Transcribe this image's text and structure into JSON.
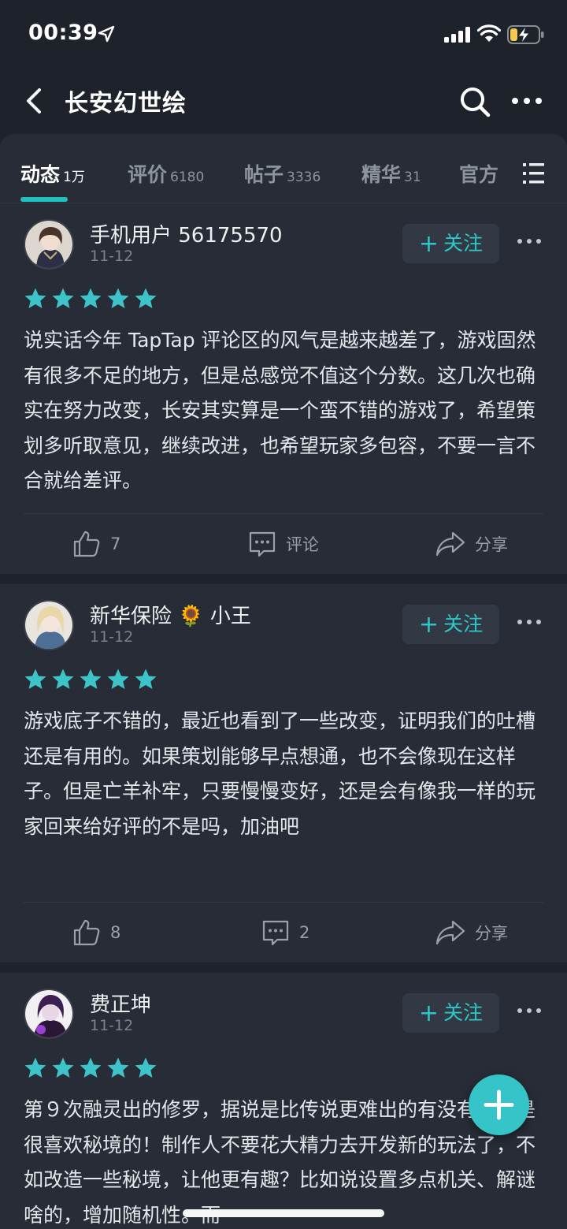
{
  "status_bar": {
    "time": "00:39"
  },
  "nav": {
    "title": "长安幻世绘"
  },
  "tabs": [
    {
      "label": "动态",
      "count": "1万",
      "active": true
    },
    {
      "label": "评价",
      "count": "6180",
      "active": false
    },
    {
      "label": "帖子",
      "count": "3336",
      "active": false
    },
    {
      "label": "精华",
      "count": "31",
      "active": false
    },
    {
      "label": "官方",
      "count": "",
      "active": false
    }
  ],
  "follow_label": "关注",
  "reviews": [
    {
      "username": "手机用户 56175570",
      "date": "11-12",
      "rating": 5,
      "text": "说实话今年 TapTap 评论区的风气是越来越差了，游戏固然有很多不足的地方，但是总感觉不值这个分数。这几次也确实在努力改变，长安其实算是一个蛮不错的游戏了，希望策划多听取意见，继续改进，也希望玩家多包容，不要一言不合就给差评。",
      "likes": "7",
      "comments": "评论",
      "share": "分享"
    },
    {
      "username": "新华保险 🌻 小王",
      "date": "11-12",
      "rating": 5,
      "text": "游戏底子不错的，最近也看到了一些改变，证明我们的吐槽还是有用的。如果策划能够早点想通，也不会像现在这样子。但是亡羊补牢，只要慢慢变好，还是会有像我一样的玩家回来给好评的不是吗，加油吧",
      "likes": "8",
      "comments": "2",
      "share": "分享"
    },
    {
      "username": "费正坤",
      "date": "11-12",
      "rating": 5,
      "text": "第９次融灵出的修罗，据说是比传说更难出的有没有？还是很喜欢秘境的！制作人不要花大精力去开发新的玩法了，不如改造一些秘境，让他更有趣？比如说设置多点机关、解谜啥的，增加随机性。而",
      "likes": "",
      "comments": "",
      "share": ""
    }
  ],
  "colors": {
    "background": "#1e222b",
    "card": "#272c36",
    "accent": "#1fc1c2",
    "star": "#3cc4c9",
    "fab": "#35c5c9"
  }
}
